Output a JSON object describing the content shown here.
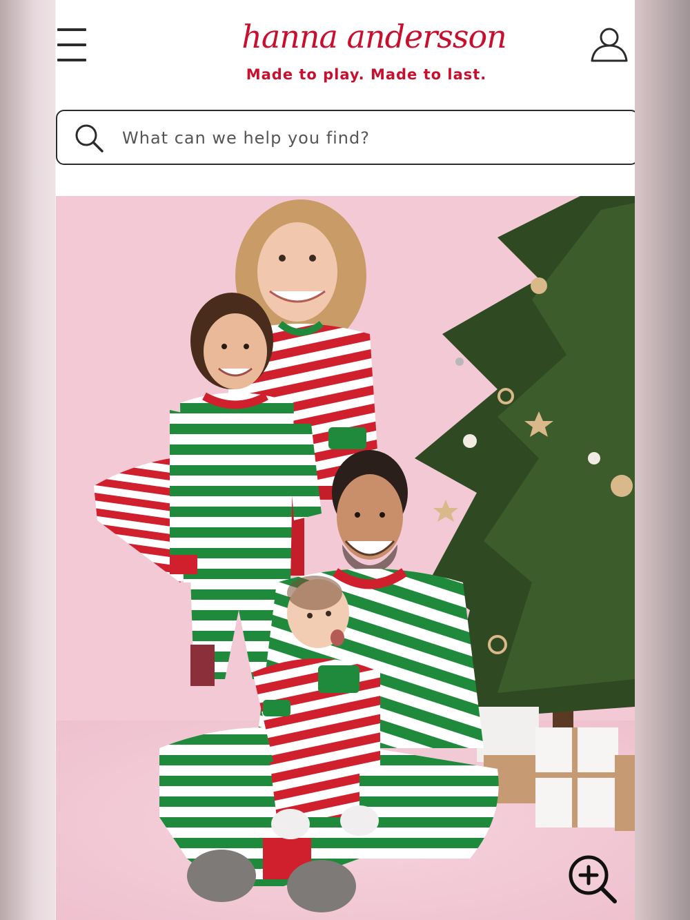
{
  "header": {
    "menu_icon": "hamburger-menu-icon",
    "logo_text": "hanna andersson",
    "tagline": "Made to play. Made to last.",
    "account_icon": "user-account-icon"
  },
  "search": {
    "placeholder": "What can we help you find?",
    "icon": "search-icon"
  },
  "hero": {
    "zoom_icon": "zoom-in-icon"
  },
  "colors": {
    "brand_red": "#c8102e",
    "stripe_green": "#1f8a3b",
    "stripe_red": "#d0202e",
    "backdrop_pink": "#f4cbd7",
    "tree_green": "#2f4a22"
  }
}
